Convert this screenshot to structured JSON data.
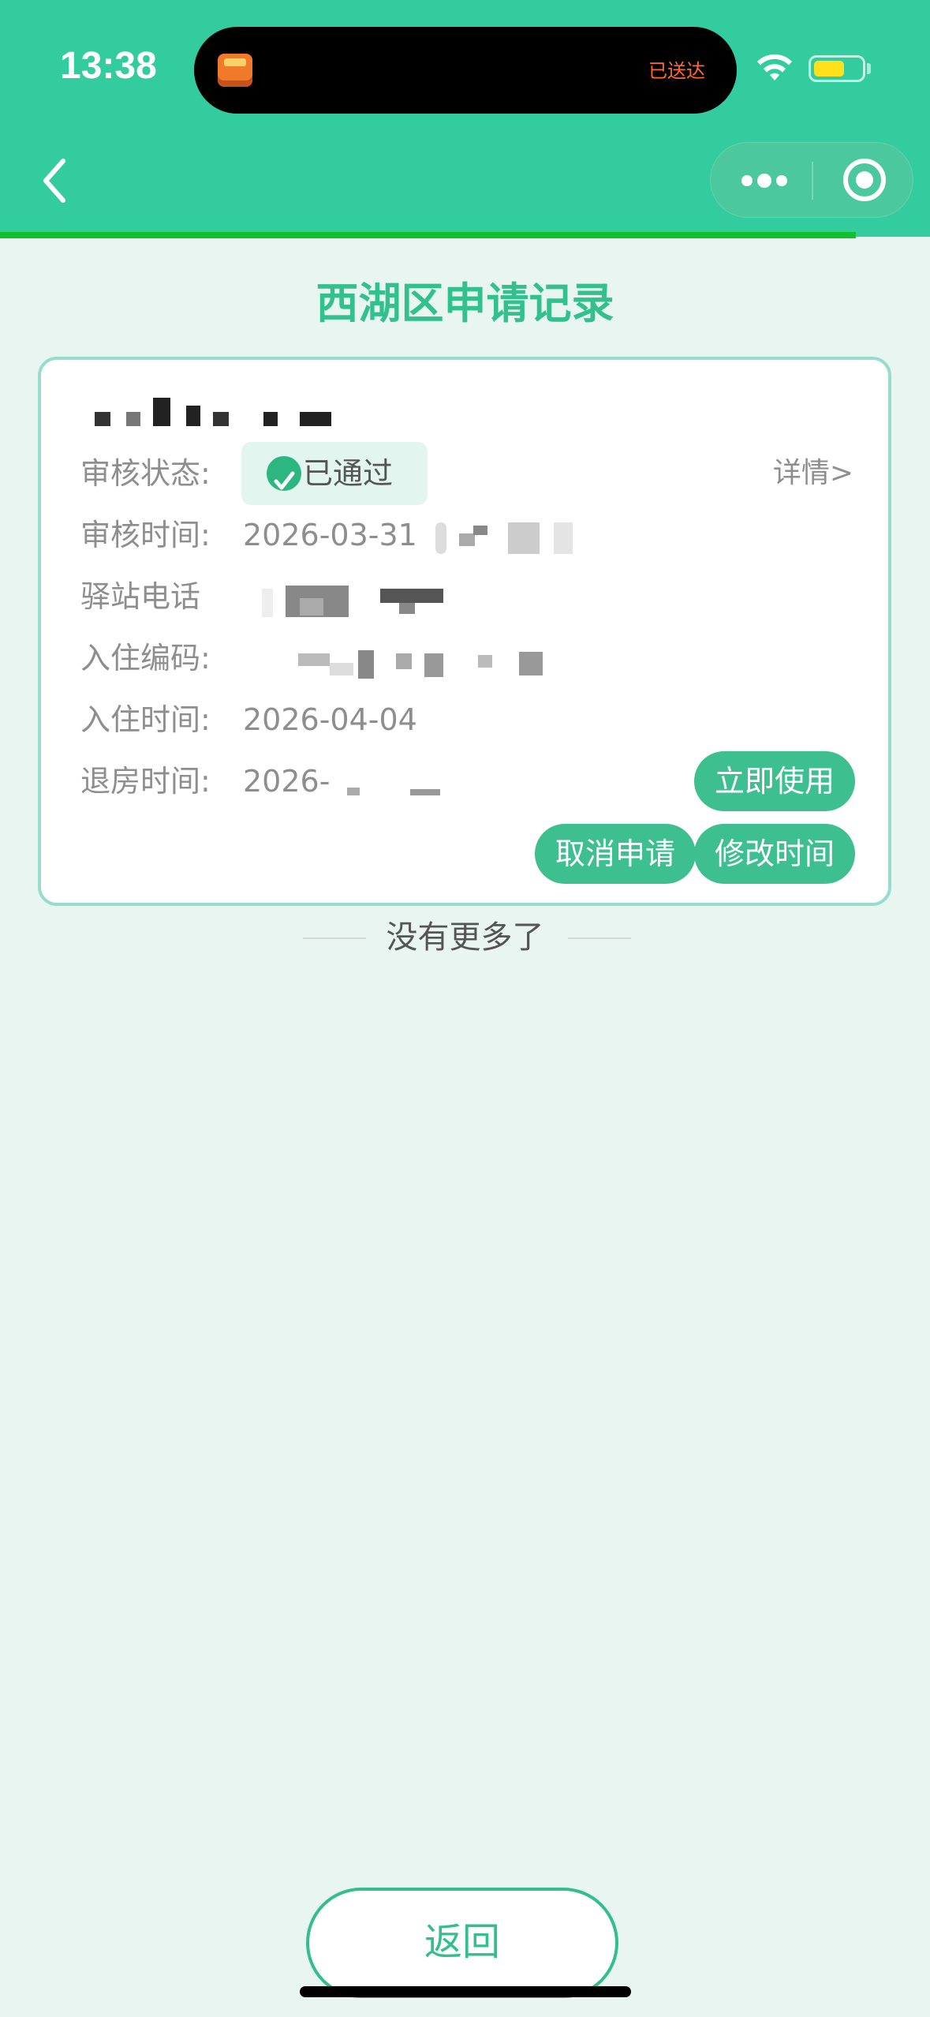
{
  "status_bar": {
    "time": "13:38",
    "island_text": "已送达",
    "battery_color": "#ffe01a"
  },
  "nav": {
    "back_icon": "chevron-left-icon",
    "more_icon": "more-dots-icon",
    "close_icon": "target-close-icon"
  },
  "page": {
    "title": "西湖区申请记录"
  },
  "record": {
    "status_label": "审核状态:",
    "status_value": "已通过",
    "details_link": "详情>",
    "review_time_label": "审核时间:",
    "review_time_value": "2026-03-31",
    "phone_label": "驿站电话",
    "code_label": "入住编码:",
    "checkin_label": "入住时间:",
    "checkin_value": "2026-04-04",
    "checkout_label": "退房时间:",
    "checkout_value": "2026-",
    "use_button": "立即使用",
    "cancel_button": "取消申请",
    "modify_button": "修改时间"
  },
  "list_footer": "没有更多了",
  "return_button": "返回",
  "colors": {
    "header": "#33cc9f",
    "accent": "#3dbf8f",
    "title": "#33c08f",
    "background": "#e9f5f1",
    "progress": "#10c12c"
  }
}
